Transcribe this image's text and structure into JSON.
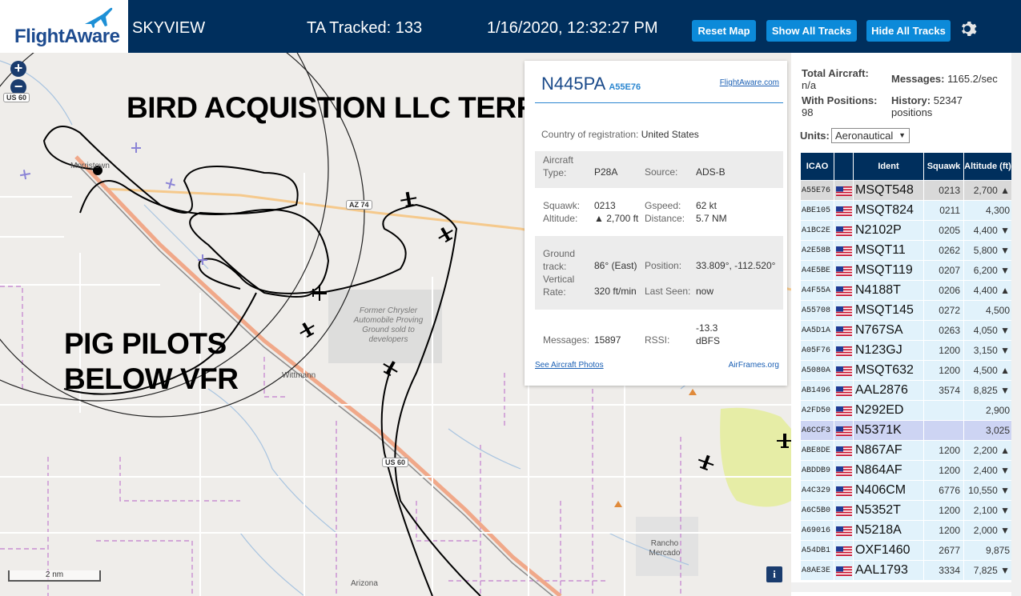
{
  "header": {
    "logo": "FlightAware",
    "app_name": "SKYVIEW",
    "tracked": "TA Tracked: 133",
    "datetime": "1/16/2020, 12:32:27 PM",
    "reset_label": "Reset Map",
    "show_all_label": "Show All Tracks",
    "hide_all_label": "Hide All Tracks",
    "gear_icon": "gear-icon"
  },
  "map": {
    "zoom_in": "+",
    "zoom_out": "−",
    "overlay_1": "BIRD ACQUISTION LLC TERRORISM",
    "overlay_2_line1": "PIG PILOTS",
    "overlay_2_line2": "BELOW VFR",
    "labels": {
      "us60_top": "US 60",
      "us60_bottom": "US 60",
      "az74": "AZ 74",
      "morristown": "Morristown",
      "wittmann": "Wittmann",
      "proving_ground": "Former Chrysler Automobile Proving Ground sold to developers",
      "rancho": "Rancho Mercado",
      "arizona": "Arizona"
    },
    "scale": "2 nm",
    "info": "i"
  },
  "popup": {
    "registration": "N445PA",
    "hex": "A55E76",
    "fa_link": "FlightAware.com",
    "country_label": "Country of registration:",
    "country": "United States",
    "aircraft_type_label_1": "Aircraft",
    "aircraft_type_label_2": "Type:",
    "aircraft_type": "P28A",
    "source_label": "Source:",
    "source": "ADS-B",
    "squawk_label": "Squawk:",
    "squawk": "0213",
    "gspeed_label": "Gspeed:",
    "gspeed": "62 kt",
    "altitude_label": "Altitude:",
    "altitude": "▲ 2,700 ft",
    "distance_label": "Distance:",
    "distance": "5.7 NM",
    "track_label_1": "Ground",
    "track_label_2": "track:",
    "track": "86° (East)",
    "position_label": "Position:",
    "position": "33.809°, -112.520°",
    "vrate_label_1": "Vertical",
    "vrate_label_2": "Rate:",
    "vrate": "320 ft/min",
    "last_seen_label": "Last Seen:",
    "last_seen": "now",
    "messages_label": "Messages:",
    "messages": "15897",
    "rssi_label": "RSSI:",
    "rssi_1": "-13.3",
    "rssi_2": "dBFS",
    "photos_link": "See Aircraft Photos",
    "airframes_link": "AirFrames.org"
  },
  "panel": {
    "total_label": "Total Aircraft:",
    "total": "n/a",
    "messages_label": "Messages:",
    "messages": "1165.2/sec",
    "positions_label": "With Positions:",
    "positions": "98",
    "history_label": "History:",
    "history_1": "52347",
    "history_2": "positions",
    "units_label": "Units:",
    "units_value": "Aeronautical",
    "columns": [
      "ICAO",
      "",
      "Ident",
      "Squawk",
      "Altitude (ft)"
    ],
    "rows": [
      {
        "icao": "A55E76",
        "ident": "MSQT548",
        "squawk": "0213",
        "alt": "2,700 ▲"
      },
      {
        "icao": "ABE105",
        "ident": "MSQT824",
        "squawk": "0211",
        "alt": "4,300"
      },
      {
        "icao": "A1BC2E",
        "ident": "N2102P",
        "squawk": "0205",
        "alt": "4,400 ▼"
      },
      {
        "icao": "A2E58B",
        "ident": "MSQT11",
        "squawk": "0262",
        "alt": "5,800 ▼"
      },
      {
        "icao": "A4E5BE",
        "ident": "MSQT119",
        "squawk": "0207",
        "alt": "6,200 ▼"
      },
      {
        "icao": "A4F55A",
        "ident": "N4188T",
        "squawk": "0206",
        "alt": "4,400 ▲"
      },
      {
        "icao": "A55708",
        "ident": "MSQT145",
        "squawk": "0272",
        "alt": "4,500"
      },
      {
        "icao": "AA5D1A",
        "ident": "N767SA",
        "squawk": "0263",
        "alt": "4,050 ▼"
      },
      {
        "icao": "A05F76",
        "ident": "N123GJ",
        "squawk": "1200",
        "alt": "3,150 ▼"
      },
      {
        "icao": "A5080A",
        "ident": "MSQT632",
        "squawk": "1200",
        "alt": "4,500 ▲"
      },
      {
        "icao": "AB1496",
        "ident": "AAL2876",
        "squawk": "3574",
        "alt": "8,825 ▼"
      },
      {
        "icao": "A2FD50",
        "ident": "N292ED",
        "squawk": "",
        "alt": "2,900"
      },
      {
        "icao": "A6CCF3",
        "ident": "N5371K",
        "squawk": "",
        "alt": "3,025"
      },
      {
        "icao": "ABE8DE",
        "ident": "N867AF",
        "squawk": "1200",
        "alt": "2,200 ▲"
      },
      {
        "icao": "ABDDB9",
        "ident": "N864AF",
        "squawk": "1200",
        "alt": "2,400 ▼"
      },
      {
        "icao": "A4C329",
        "ident": "N406CM",
        "squawk": "6776",
        "alt": "10,550 ▼"
      },
      {
        "icao": "A6C5B0",
        "ident": "N5352T",
        "squawk": "1200",
        "alt": "2,100 ▼"
      },
      {
        "icao": "A69016",
        "ident": "N5218A",
        "squawk": "1200",
        "alt": "2,000 ▼"
      },
      {
        "icao": "A54DB1",
        "ident": "OXF1460",
        "squawk": "2677",
        "alt": "9,875"
      },
      {
        "icao": "A8AE3E",
        "ident": "AAL1793",
        "squawk": "3334",
        "alt": "7,825 ▼"
      }
    ]
  },
  "colors": {
    "header_bg": "#002f5d",
    "button_bg": "#0c8ad9",
    "table_row": "#e1f2fb",
    "link": "#1a5fb4"
  }
}
